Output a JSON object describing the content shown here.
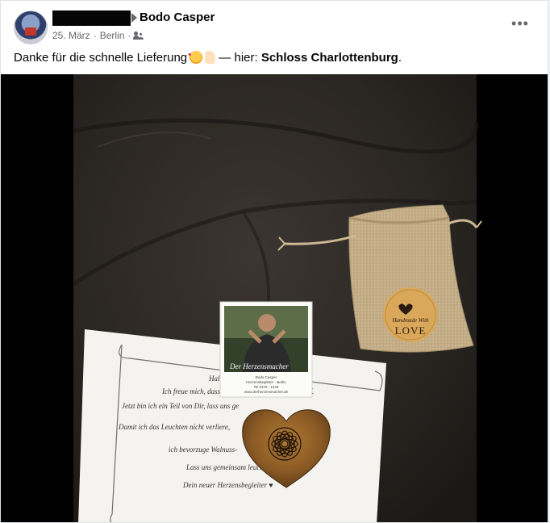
{
  "post": {
    "author": "Bodo Casper",
    "date": "25. März",
    "separator": "·",
    "location": "Berlin",
    "audience_icon": "friends-icon",
    "more_label": "•••",
    "text_before": "Danke für die schnelle Lieferung",
    "text_after": " — hier: ",
    "place": "Schloss Charlottenburg",
    "text_end": "."
  },
  "photo": {
    "bag_label_line1": "Handmade With",
    "bag_label_line2": "LOVE",
    "card_caption": "Der Herzensmacher",
    "card_address_1": "Bodo Casper",
    "card_address_2": "Herzensbegleiter · Berlin",
    "card_address_3": "Tel 0176 · 1234",
    "card_address_4": "www.derherzensmacher.de",
    "letter_lines": [
      "Hallo",
      "Ich freue mich, dass ich Dich ab jetzt begleiten darf.",
      "Jetzt bin ich ein Teil von Dir, lass uns ge",
      "Damit ich das Leuchten nicht verliere,",
      "ich bevorzuge Walnuss-",
      "Lass uns gemeinsam leuchten",
      "Dein neuer Herzensbegleiter ♥"
    ],
    "colors": {
      "leather": "#2a2622",
      "burlap": "#c9b48f",
      "wood": "#8a5a25",
      "paper": "#f4f3ef"
    }
  }
}
